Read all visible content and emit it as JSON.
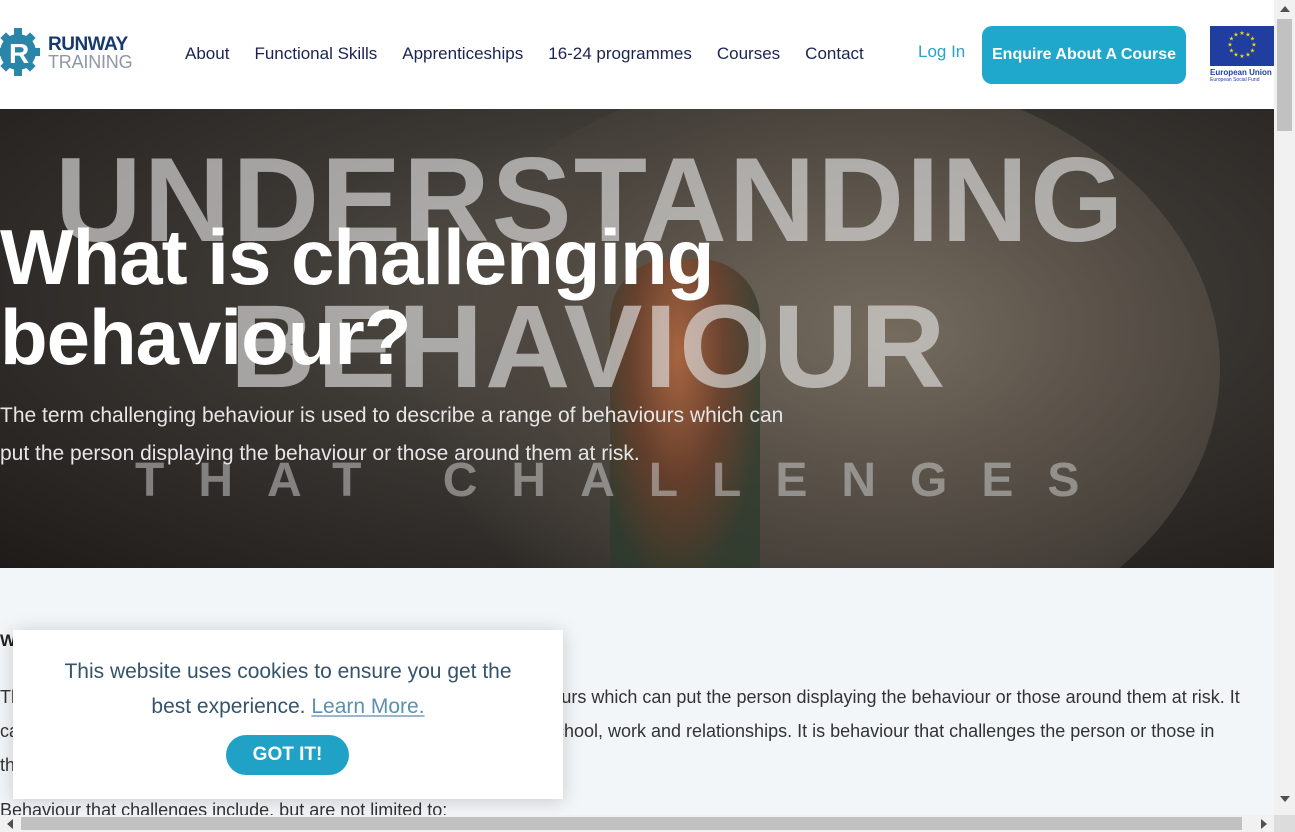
{
  "header": {
    "logo": {
      "line1": "RUNWAY",
      "line2": "TRAINING"
    },
    "nav": [
      "About",
      "Functional Skills",
      "Apprenticeships",
      "16-24 programmes",
      "Courses",
      "Contact"
    ],
    "login_label": "Log In",
    "enquire_label": "Enquire About A Course",
    "eu_logo": {
      "line1": "European Union",
      "line2": "European Social Fund"
    }
  },
  "hero": {
    "background_words": [
      "UNDERSTANDING",
      "BEHAVIOUR",
      "THAT CHALLENGES"
    ],
    "title": "What is challenging behaviour?",
    "subtitle": "The term challenging behaviour is used to describe a range of behaviours which can put the person displaying the behaviour or those around them at risk."
  },
  "content": {
    "heading": "W",
    "paragraph": "The term challenging behaviour is used to describe a range of behaviours which can put the person displaying the behaviour or those around them at risk. It can affect their ability to participate in various aspects of life such as school, work and relationships. It is behaviour that challenges the person or those in their community and usually not seen as socially acceptable.",
    "next_line": "Behaviour that challenges include, but are not limited to:"
  },
  "cookie": {
    "message": "This website uses cookies to ensure you get the best experience.",
    "link": "Learn More.",
    "button": "GOT IT!"
  },
  "colors": {
    "brand_navy": "#1b2352",
    "accent_teal": "#1fa8cc",
    "eu_blue": "#1f3ea0"
  }
}
